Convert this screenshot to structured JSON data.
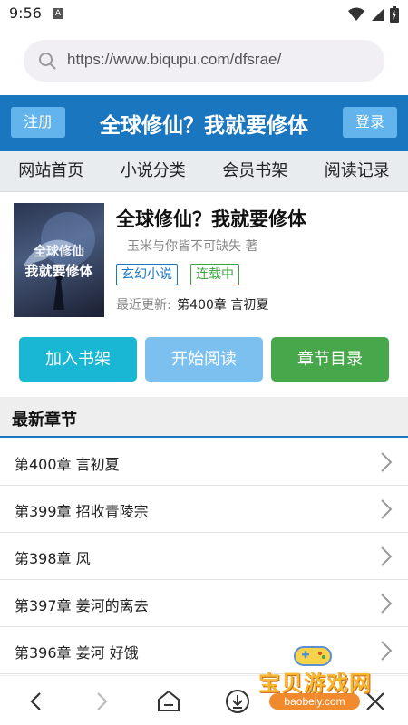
{
  "status_bar": {
    "time": "9:56",
    "app_icon_letter": "A"
  },
  "browser": {
    "url": "https://www.biqupu.com/dfsrae/"
  },
  "header": {
    "register_label": "注册",
    "title": "全球修仙？我就要修体",
    "login_label": "登录",
    "accent_color": "#1a76be"
  },
  "nav": {
    "items": [
      {
        "label": "网站首页"
      },
      {
        "label": "小说分类"
      },
      {
        "label": "会员书架"
      },
      {
        "label": "阅读记录"
      }
    ]
  },
  "book": {
    "cover_text_line1": "全球修仙",
    "cover_text_line2": "我就要修体",
    "title": "全球修仙？我就要修体",
    "author": "玉米与你皆不可缺失 著",
    "genre_tag": "玄幻小说",
    "status_tag": "连载中",
    "latest_label": "最近更新:",
    "latest_chapter": "第400章 言初夏"
  },
  "actions": {
    "add_shelf": "加入书架",
    "start_reading": "开始阅读",
    "chapter_toc": "章节目录"
  },
  "latest_section": {
    "title": "最新章节",
    "chapters": [
      {
        "label": "第400章 言初夏"
      },
      {
        "label": "第399章 招收青陵宗"
      },
      {
        "label": "第398章 风"
      },
      {
        "label": "第397章 姜河的离去"
      },
      {
        "label": "第396章 姜河 好饿"
      }
    ]
  },
  "watermark": {
    "text": "宝贝游戏网",
    "url": "baobeiy.com"
  }
}
